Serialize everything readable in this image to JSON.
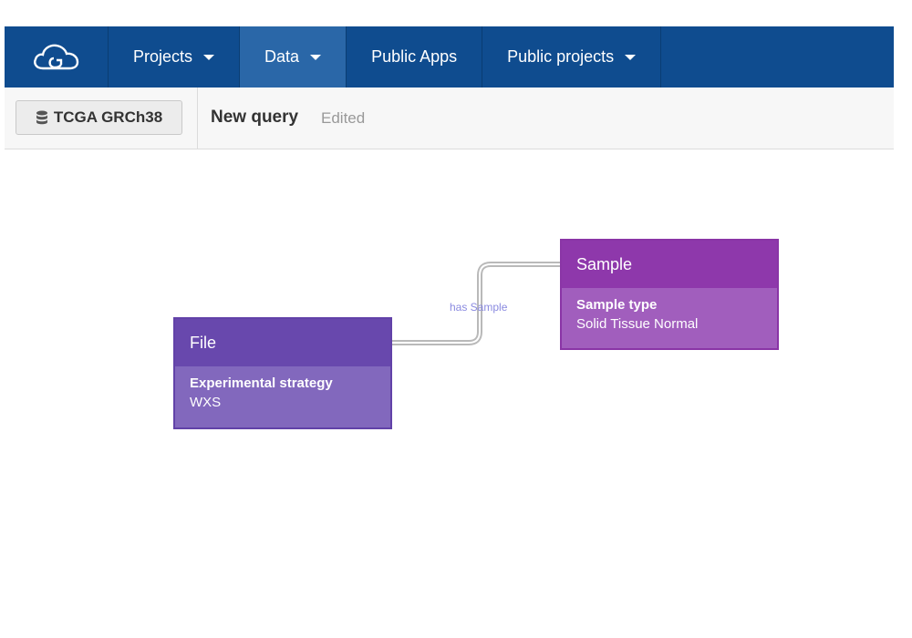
{
  "navbar": {
    "logo_icon": "cloud-logo-icon",
    "items": [
      {
        "label": "Projects",
        "has_caret": true
      },
      {
        "label": "Data",
        "has_caret": true,
        "active": true
      },
      {
        "label": "Public Apps",
        "has_caret": false
      },
      {
        "label": "Public projects",
        "has_caret": true
      }
    ]
  },
  "toolbar": {
    "datasource_label": "TCGA GRCh38",
    "datasource_icon": "database-icon",
    "query_title": "New query",
    "query_status": "Edited"
  },
  "graph": {
    "nodes": [
      {
        "title": "File",
        "attribute": "Experimental strategy",
        "value": "WXS",
        "color": "#6848ad"
      },
      {
        "title": "Sample",
        "attribute": "Sample type",
        "value": "Solid Tissue Normal",
        "color": "#8e38ab"
      }
    ],
    "edge_label": "has Sample"
  },
  "colors": {
    "navbar": "#0f4c8f",
    "navbar_active": "#2a67a8",
    "edge_label": "#8a8ae0"
  }
}
